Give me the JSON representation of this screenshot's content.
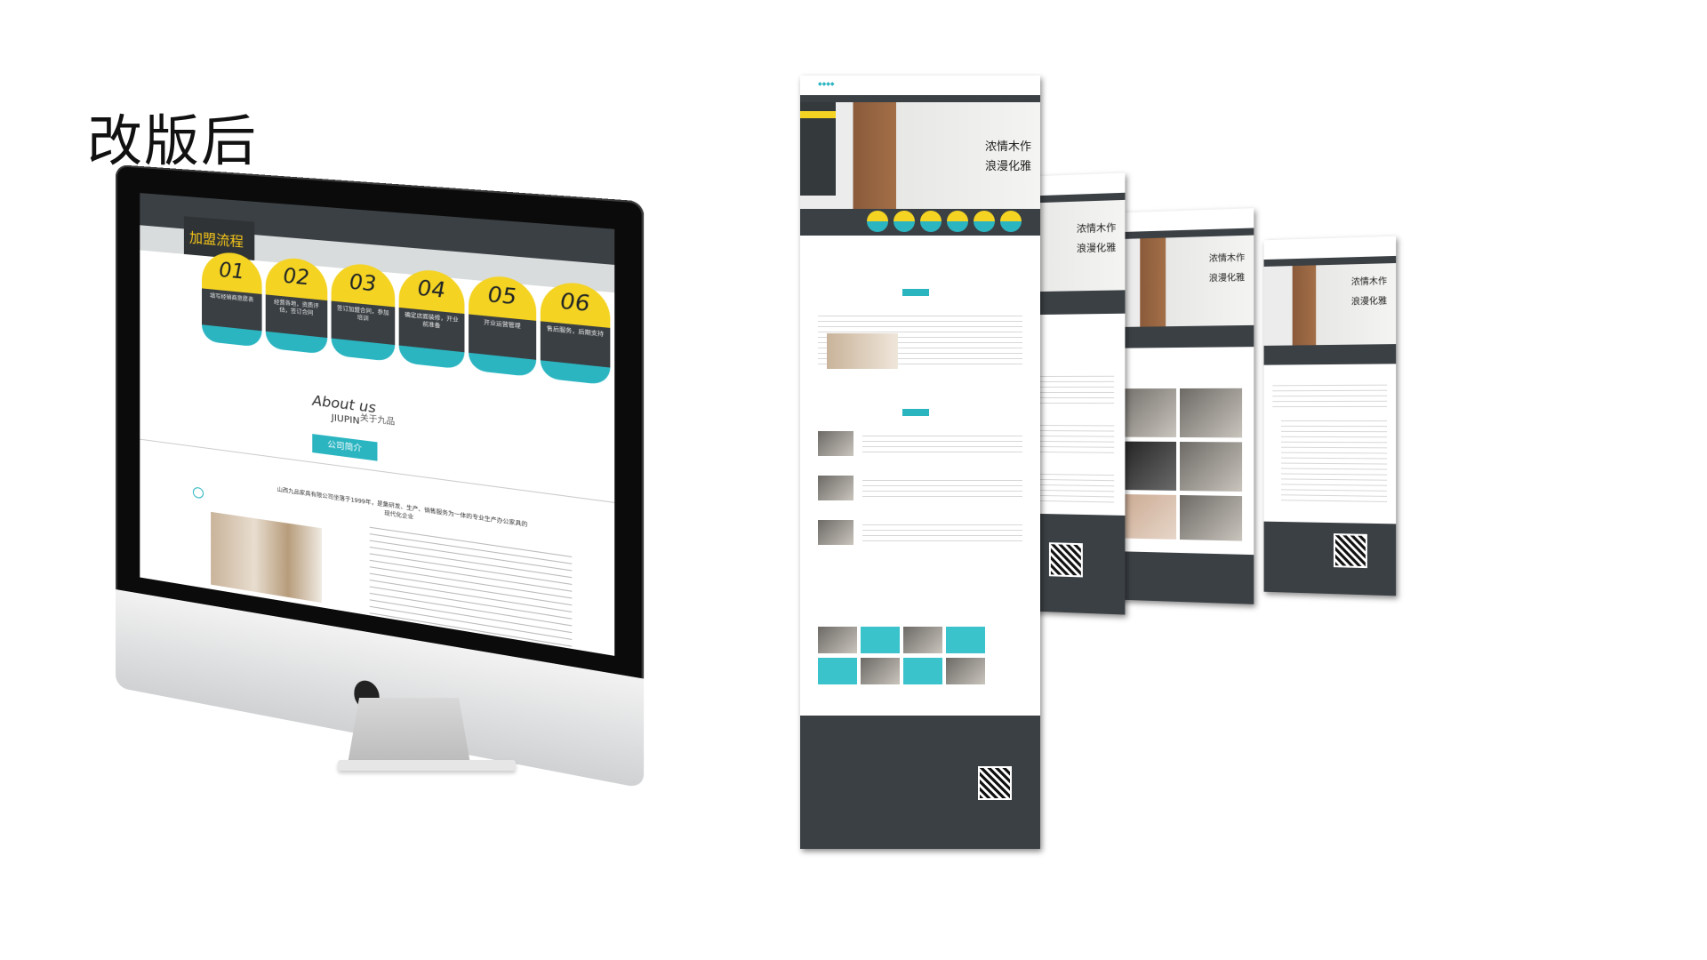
{
  "heading": "改版后",
  "imac": {
    "join_title": "加盟流程",
    "steps": [
      {
        "num": "01",
        "text": "填写经销商意愿表"
      },
      {
        "num": "02",
        "text": "经营各地，资质评估，签订合同"
      },
      {
        "num": "03",
        "text": "签订加盟合同，参加培训"
      },
      {
        "num": "04",
        "text": "确定店面装修，开业前准备"
      },
      {
        "num": "05",
        "text": "开业运营管理"
      },
      {
        "num": "06",
        "text": "售后服务，后期支持"
      }
    ],
    "about_en": "About us",
    "about_brand": "JIUPIN",
    "about_cn": "关于九品",
    "about_button": "公司简介",
    "intro": "山西九品家具有限公司坐落于1999年，是集研发、生产、销售服务为一体的专业生产办公家具的现代化企业"
  },
  "pages": {
    "slogan_line1": "浓情木作",
    "slogan_line2": "浪漫化雅"
  }
}
